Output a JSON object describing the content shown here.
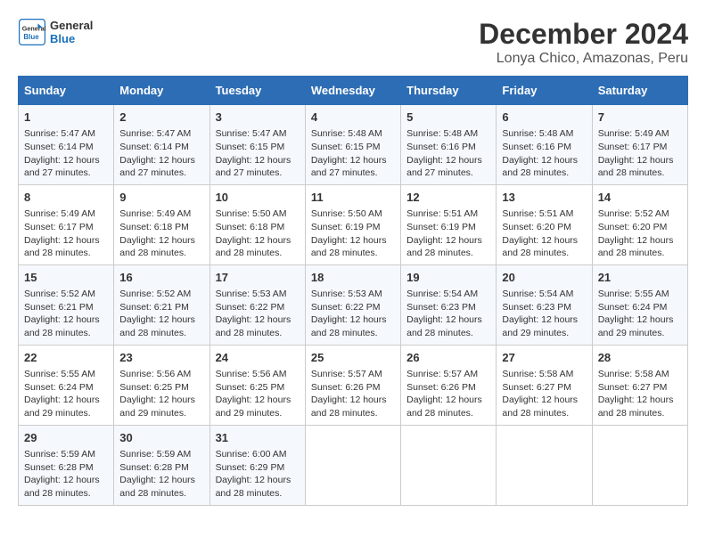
{
  "logo": {
    "line1": "General",
    "line2": "Blue"
  },
  "title": "December 2024",
  "subtitle": "Lonya Chico, Amazonas, Peru",
  "days_header": [
    "Sunday",
    "Monday",
    "Tuesday",
    "Wednesday",
    "Thursday",
    "Friday",
    "Saturday"
  ],
  "weeks": [
    [
      {
        "day": "1",
        "info": "Sunrise: 5:47 AM\nSunset: 6:14 PM\nDaylight: 12 hours\nand 27 minutes."
      },
      {
        "day": "2",
        "info": "Sunrise: 5:47 AM\nSunset: 6:14 PM\nDaylight: 12 hours\nand 27 minutes."
      },
      {
        "day": "3",
        "info": "Sunrise: 5:47 AM\nSunset: 6:15 PM\nDaylight: 12 hours\nand 27 minutes."
      },
      {
        "day": "4",
        "info": "Sunrise: 5:48 AM\nSunset: 6:15 PM\nDaylight: 12 hours\nand 27 minutes."
      },
      {
        "day": "5",
        "info": "Sunrise: 5:48 AM\nSunset: 6:16 PM\nDaylight: 12 hours\nand 27 minutes."
      },
      {
        "day": "6",
        "info": "Sunrise: 5:48 AM\nSunset: 6:16 PM\nDaylight: 12 hours\nand 28 minutes."
      },
      {
        "day": "7",
        "info": "Sunrise: 5:49 AM\nSunset: 6:17 PM\nDaylight: 12 hours\nand 28 minutes."
      }
    ],
    [
      {
        "day": "8",
        "info": "Sunrise: 5:49 AM\nSunset: 6:17 PM\nDaylight: 12 hours\nand 28 minutes."
      },
      {
        "day": "9",
        "info": "Sunrise: 5:49 AM\nSunset: 6:18 PM\nDaylight: 12 hours\nand 28 minutes."
      },
      {
        "day": "10",
        "info": "Sunrise: 5:50 AM\nSunset: 6:18 PM\nDaylight: 12 hours\nand 28 minutes."
      },
      {
        "day": "11",
        "info": "Sunrise: 5:50 AM\nSunset: 6:19 PM\nDaylight: 12 hours\nand 28 minutes."
      },
      {
        "day": "12",
        "info": "Sunrise: 5:51 AM\nSunset: 6:19 PM\nDaylight: 12 hours\nand 28 minutes."
      },
      {
        "day": "13",
        "info": "Sunrise: 5:51 AM\nSunset: 6:20 PM\nDaylight: 12 hours\nand 28 minutes."
      },
      {
        "day": "14",
        "info": "Sunrise: 5:52 AM\nSunset: 6:20 PM\nDaylight: 12 hours\nand 28 minutes."
      }
    ],
    [
      {
        "day": "15",
        "info": "Sunrise: 5:52 AM\nSunset: 6:21 PM\nDaylight: 12 hours\nand 28 minutes."
      },
      {
        "day": "16",
        "info": "Sunrise: 5:52 AM\nSunset: 6:21 PM\nDaylight: 12 hours\nand 28 minutes."
      },
      {
        "day": "17",
        "info": "Sunrise: 5:53 AM\nSunset: 6:22 PM\nDaylight: 12 hours\nand 28 minutes."
      },
      {
        "day": "18",
        "info": "Sunrise: 5:53 AM\nSunset: 6:22 PM\nDaylight: 12 hours\nand 28 minutes."
      },
      {
        "day": "19",
        "info": "Sunrise: 5:54 AM\nSunset: 6:23 PM\nDaylight: 12 hours\nand 28 minutes."
      },
      {
        "day": "20",
        "info": "Sunrise: 5:54 AM\nSunset: 6:23 PM\nDaylight: 12 hours\nand 29 minutes."
      },
      {
        "day": "21",
        "info": "Sunrise: 5:55 AM\nSunset: 6:24 PM\nDaylight: 12 hours\nand 29 minutes."
      }
    ],
    [
      {
        "day": "22",
        "info": "Sunrise: 5:55 AM\nSunset: 6:24 PM\nDaylight: 12 hours\nand 29 minutes."
      },
      {
        "day": "23",
        "info": "Sunrise: 5:56 AM\nSunset: 6:25 PM\nDaylight: 12 hours\nand 29 minutes."
      },
      {
        "day": "24",
        "info": "Sunrise: 5:56 AM\nSunset: 6:25 PM\nDaylight: 12 hours\nand 29 minutes."
      },
      {
        "day": "25",
        "info": "Sunrise: 5:57 AM\nSunset: 6:26 PM\nDaylight: 12 hours\nand 28 minutes."
      },
      {
        "day": "26",
        "info": "Sunrise: 5:57 AM\nSunset: 6:26 PM\nDaylight: 12 hours\nand 28 minutes."
      },
      {
        "day": "27",
        "info": "Sunrise: 5:58 AM\nSunset: 6:27 PM\nDaylight: 12 hours\nand 28 minutes."
      },
      {
        "day": "28",
        "info": "Sunrise: 5:58 AM\nSunset: 6:27 PM\nDaylight: 12 hours\nand 28 minutes."
      }
    ],
    [
      {
        "day": "29",
        "info": "Sunrise: 5:59 AM\nSunset: 6:28 PM\nDaylight: 12 hours\nand 28 minutes."
      },
      {
        "day": "30",
        "info": "Sunrise: 5:59 AM\nSunset: 6:28 PM\nDaylight: 12 hours\nand 28 minutes."
      },
      {
        "day": "31",
        "info": "Sunrise: 6:00 AM\nSunset: 6:29 PM\nDaylight: 12 hours\nand 28 minutes."
      },
      {
        "day": "",
        "info": ""
      },
      {
        "day": "",
        "info": ""
      },
      {
        "day": "",
        "info": ""
      },
      {
        "day": "",
        "info": ""
      }
    ]
  ]
}
